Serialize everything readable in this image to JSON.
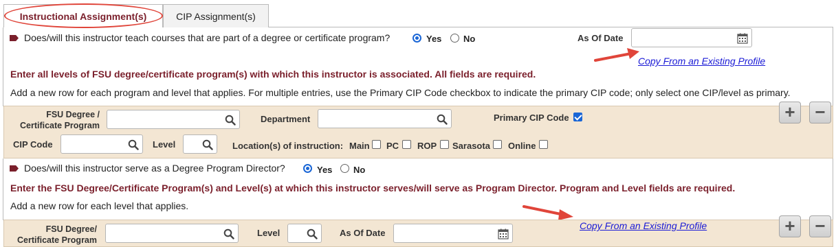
{
  "tabs": {
    "instructional": "Instructional Assignment(s)",
    "cip": "CIP Assignment(s)"
  },
  "q1": {
    "question": "Does/will this instructor teach courses that are part of a degree or certificate program?",
    "yes": "Yes",
    "no": "No",
    "selected": "Yes",
    "as_of_date_label": "As Of Date",
    "as_of_date_value": "",
    "copy_link": "Copy From an Existing Profile"
  },
  "programs": {
    "heading": "Enter all levels of FSU degree/certificate program(s) with which this instructor is associated. All fields are required.",
    "instructions": "Add a new row for each program and level that applies. For multiple entries, use the Primary CIP Code checkbox to indicate the primary CIP code; only select one CIP/level as primary.",
    "row": {
      "program_label_1": "FSU Degree /",
      "program_label_2": "Certificate Program",
      "program_value": "",
      "department_label": "Department",
      "department_value": "",
      "primary_cip_label": "Primary CIP Code",
      "primary_cip_checked": true,
      "cip_code_label": "CIP Code",
      "cip_code_value": "",
      "level_label": "Level",
      "level_value": "",
      "locations_label": "Location(s) of instruction:",
      "locations": [
        {
          "label": "Main",
          "checked": false
        },
        {
          "label": "PC",
          "checked": false
        },
        {
          "label": "ROP",
          "checked": false
        },
        {
          "label": "Sarasota",
          "checked": false
        },
        {
          "label": "Online",
          "checked": false
        }
      ]
    },
    "add": "+",
    "remove": "−"
  },
  "q2": {
    "question": "Does/will this instructor serve as a Degree Program Director?",
    "yes": "Yes",
    "no": "No",
    "selected": "Yes"
  },
  "director": {
    "heading": "Enter the FSU Degree/Certificate Program(s) and Level(s) at which this instructor serves/will serve as Program Director. Program and Level fields are required.",
    "instructions": "Add a new row for each level that applies.",
    "copy_link": "Copy From an Existing Profile",
    "row": {
      "program_label_1": "FSU Degree/",
      "program_label_2": "Certificate Program",
      "program_value": "",
      "level_label": "Level",
      "level_value": "",
      "as_of_date_label": "As Of Date",
      "as_of_date_value": ""
    },
    "add": "+",
    "remove": "−"
  },
  "colors": {
    "accent": "#7a1f2b",
    "beige": "#f3e6d3",
    "link": "#1a1ad6",
    "annotation": "#e0453a",
    "radio": "#1a66d6"
  },
  "icons": {
    "lookup": "magnifier-icon",
    "calendar": "calendar-icon",
    "bullet": "bullet-tag-icon",
    "arrow": "red-annotation-arrow"
  }
}
